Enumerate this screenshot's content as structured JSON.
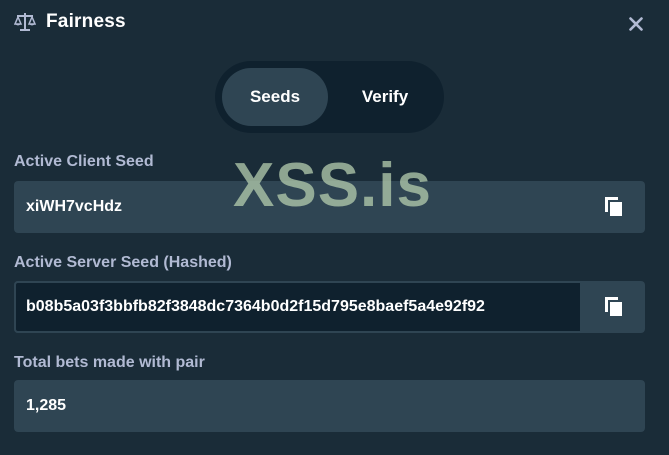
{
  "modal": {
    "title": "Fairness",
    "icons": {
      "title": "scale-icon",
      "close": "close-icon",
      "copy": "copy-icon"
    }
  },
  "tabs": [
    {
      "label": "Seeds",
      "active": true
    },
    {
      "label": "Verify",
      "active": false
    }
  ],
  "client_seed": {
    "label": "Active Client Seed",
    "value": "xiWH7vcHdz"
  },
  "server_seed": {
    "label": "Active Server Seed (Hashed)",
    "value": "b08b5a03f3bbfb82f3848dc7364b0d2f15d795e8baef5a4e92f92"
  },
  "total_bets": {
    "label": "Total bets made with pair",
    "value": "1,285"
  },
  "watermark": "XSS.is",
  "colors": {
    "background": "#1a2c38",
    "surface": "#2f4553",
    "dark_surface": "#0f212e",
    "label_text": "#b1bad3"
  }
}
